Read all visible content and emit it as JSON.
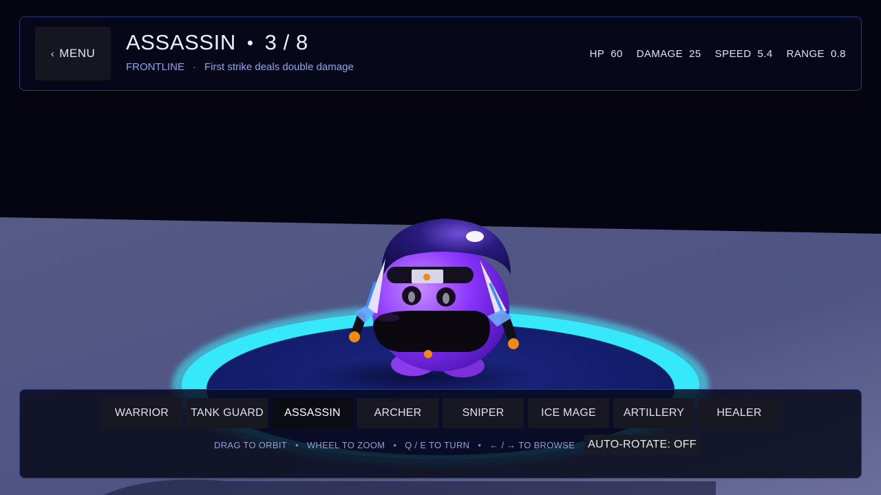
{
  "header": {
    "menu_label": "MENU",
    "unit_name": "ASSASSIN",
    "counter": "3 / 8",
    "role": "FRONTLINE",
    "ability": "First strike deals double damage",
    "stats": [
      {
        "label": "HP",
        "value": "60"
      },
      {
        "label": "DAMAGE",
        "value": "25"
      },
      {
        "label": "SPEED",
        "value": "5.4"
      },
      {
        "label": "RANGE",
        "value": "0.8"
      }
    ]
  },
  "tabs": [
    "WARRIOR",
    "TANK GUARD",
    "ASSASSIN",
    "ARCHER",
    "SNIPER",
    "ICE MAGE",
    "ARTILLERY",
    "HEALER"
  ],
  "active_tab": "ASSASSIN",
  "hints": [
    "DRAG TO ORBIT",
    "WHEEL TO ZOOM",
    "Q / E TO TURN",
    "← / → TO BROWSE"
  ],
  "auto_rotate_label": "AUTO-ROTATE: OFF",
  "colors": {
    "accent_cyan": "#3ff2ff",
    "panel_border": "#2a3a78",
    "character_purple": "#7a2dff",
    "subtitle_blue": "#93a6ea"
  },
  "icons": {
    "menu_back": "chevron-left-icon",
    "separator": "bullet"
  }
}
